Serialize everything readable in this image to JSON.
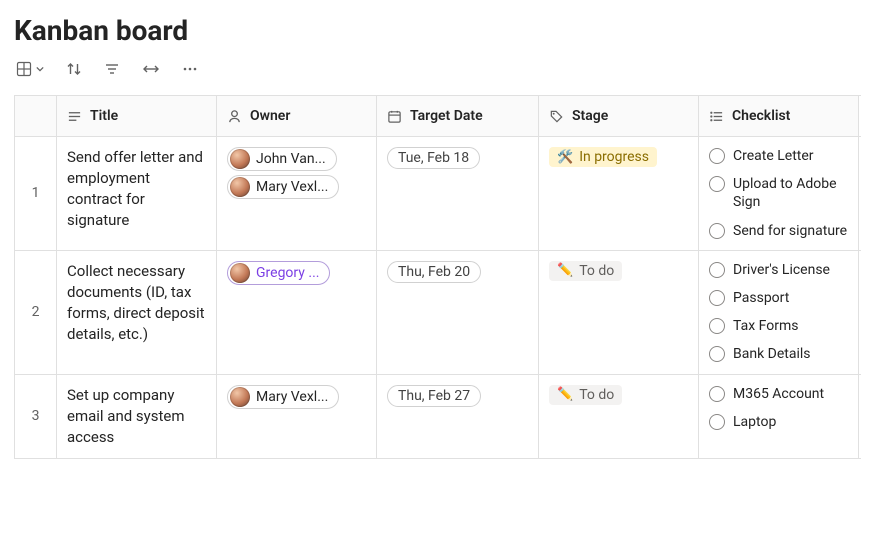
{
  "title": "Kanban board",
  "columns": {
    "title": "Title",
    "owner": "Owner",
    "target_date": "Target Date",
    "stage": "Stage",
    "checklist": "Checklist"
  },
  "stages": {
    "in_progress": {
      "emoji": "🛠️",
      "label": "In progress"
    },
    "to_do": {
      "emoji": "✏️",
      "label": "To do"
    }
  },
  "rows": [
    {
      "num": "1",
      "title": "Send offer letter and employment contract for signature",
      "owners": [
        {
          "name": "John Van...",
          "highlight": false
        },
        {
          "name": "Mary Vexl...",
          "highlight": false
        }
      ],
      "date": "Tue, Feb 18",
      "stage": "in_progress",
      "checklist": [
        "Create Letter",
        "Upload to Adobe Sign",
        "Send for signature"
      ]
    },
    {
      "num": "2",
      "title": "Collect necessary documents (ID, tax forms, direct deposit details, etc.)",
      "owners": [
        {
          "name": "Gregory ...",
          "highlight": true
        }
      ],
      "date": "Thu, Feb 20",
      "stage": "to_do",
      "checklist": [
        "Driver's License",
        "Passport",
        "Tax Forms",
        "Bank Details"
      ]
    },
    {
      "num": "3",
      "title": "Set up company email and system access",
      "owners": [
        {
          "name": "Mary Vexl...",
          "highlight": false
        }
      ],
      "date": "Thu, Feb 27",
      "stage": "to_do",
      "checklist": [
        "M365 Account",
        "Laptop"
      ]
    }
  ]
}
